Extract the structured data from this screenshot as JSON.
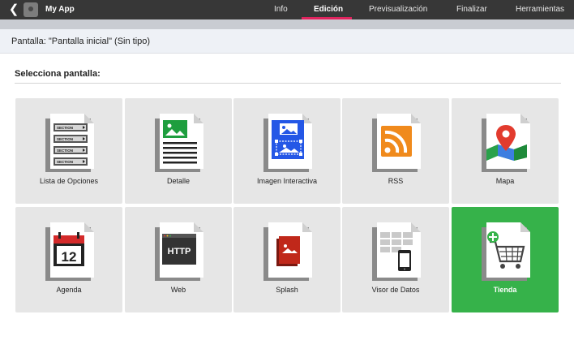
{
  "header": {
    "back_icon": "chevron-left-icon",
    "app_icon": "app-icon",
    "app_title": "My App",
    "tabs": [
      {
        "label": "Info",
        "active": false
      },
      {
        "label": "Edición",
        "active": true
      },
      {
        "label": "Previsualización",
        "active": false
      },
      {
        "label": "Finalizar",
        "active": false
      },
      {
        "label": "Herramientas",
        "active": false
      }
    ],
    "accent_color": "#e0245e"
  },
  "screen_bar": {
    "label": "Pantalla: \"Pantalla inicial\" (Sin tipo)"
  },
  "section": {
    "title": "Selecciona pantalla:"
  },
  "tiles": [
    {
      "label": "Lista de Opciones",
      "icon": "section-list-icon",
      "selected": false
    },
    {
      "label": "Detalle",
      "icon": "detail-page-icon",
      "selected": false
    },
    {
      "label": "Imagen Interactiva",
      "icon": "interactive-image-icon",
      "selected": false
    },
    {
      "label": "RSS",
      "icon": "rss-icon",
      "selected": false
    },
    {
      "label": "Mapa",
      "icon": "map-pin-icon",
      "selected": false
    },
    {
      "label": "Agenda",
      "icon": "calendar-icon",
      "selected": false
    },
    {
      "label": "Web",
      "icon": "http-browser-icon",
      "selected": false
    },
    {
      "label": "Splash",
      "icon": "splash-image-icon",
      "selected": false
    },
    {
      "label": "Visor de Datos",
      "icon": "data-viewer-icon",
      "selected": false
    },
    {
      "label": "Tienda",
      "icon": "shopping-cart-icon",
      "selected": true
    }
  ],
  "icon_texts": {
    "section_row": "SECTION",
    "http": "HTTP",
    "calendar_day": "12"
  },
  "colors": {
    "tile_bg": "#e6e6e6",
    "tile_selected_bg": "#36b24a",
    "detail_green": "#1e9e3e",
    "interactive_blue": "#2457e6",
    "rss_orange": "#f08a1c",
    "map_red": "#e23b2e",
    "splash_red": "#c0281a"
  }
}
